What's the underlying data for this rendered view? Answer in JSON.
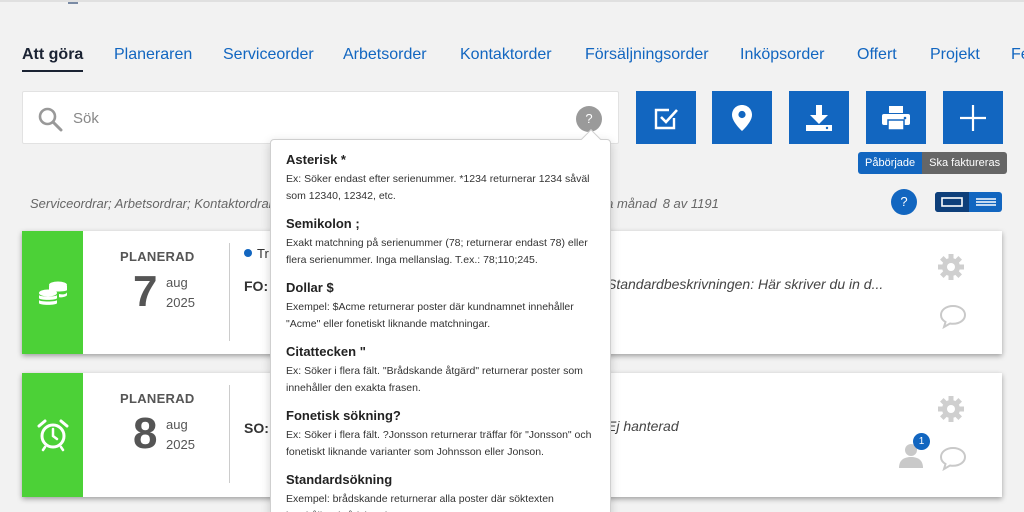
{
  "tabs": [
    {
      "label": "Att göra",
      "active": true
    },
    {
      "label": "Planeraren"
    },
    {
      "label": "Serviceorder"
    },
    {
      "label": "Arbetsorder"
    },
    {
      "label": "Kontaktorder"
    },
    {
      "label": "Försäljningsorder"
    },
    {
      "label": "Inköpsorder"
    },
    {
      "label": "Offert"
    },
    {
      "label": "Projekt"
    },
    {
      "label": "Fe"
    }
  ],
  "search": {
    "placeholder": "Sök",
    "help_label": "?"
  },
  "actions": [
    {
      "icon": "checkbox-icon"
    },
    {
      "icon": "location-pin-icon"
    },
    {
      "icon": "download-icon"
    },
    {
      "icon": "print-icon"
    },
    {
      "icon": "plus-icon"
    }
  ],
  "filters": {
    "started": "Påbörjade",
    "to_invoice": "Ska faktureras"
  },
  "breadcrumb": {
    "left": "Serviceordrar; Arbetsordrar; Kontaktordrar,",
    "right_period": "sta månad",
    "count": "8 av 1191"
  },
  "help_label": "?",
  "colors": {
    "primary": "#1266c0",
    "status_green": "#4cd137",
    "pill_gray": "#666666"
  },
  "cards": [
    {
      "status": "PLANERAD",
      "day": "7",
      "month": "aug",
      "year": "2025",
      "tag": "Tr",
      "ref": "FO:",
      "description": "Standardbeskrivningen: Här skriver du in d...",
      "icon": "coins-icon"
    },
    {
      "status": "PLANERAD",
      "day": "8",
      "month": "aug",
      "year": "2025",
      "ref": "SO:",
      "description": "Ej hanterad",
      "icon": "alarm-clock-icon",
      "badge": "1"
    }
  ],
  "popover": {
    "items": [
      {
        "title": "Asterisk *",
        "text": "Ex: Söker endast efter serienummer. *1234 returnerar 1234 såväl som 12340, 12342, etc."
      },
      {
        "title": "Semikolon ;",
        "text": "Exakt matchning på serienummer (78; returnerar endast 78) eller flera serienummer. Inga mellanslag. T.ex.: 78;110;245."
      },
      {
        "title": "Dollar $",
        "text": "Exempel: $Acme returnerar poster där kundnamnet innehåller \"Acme\" eller fonetiskt liknande matchningar."
      },
      {
        "title": "Citattecken \"",
        "text": "Ex: Söker i flera fält. \"Brådskande åtgärd\" returnerar poster som innehåller den exakta frasen."
      },
      {
        "title": "Fonetisk sökning?",
        "text": "Ex: Söker i flera fält. ?Jonsson returnerar träffar för \"Jonsson\" och fonetiskt liknande varianter som Johnsson eller Jonson."
      },
      {
        "title": "Standardsökning",
        "text": "Exempel: brådskande returnerar alla poster där söktexten innehåller \"brådskande\"."
      }
    ]
  }
}
